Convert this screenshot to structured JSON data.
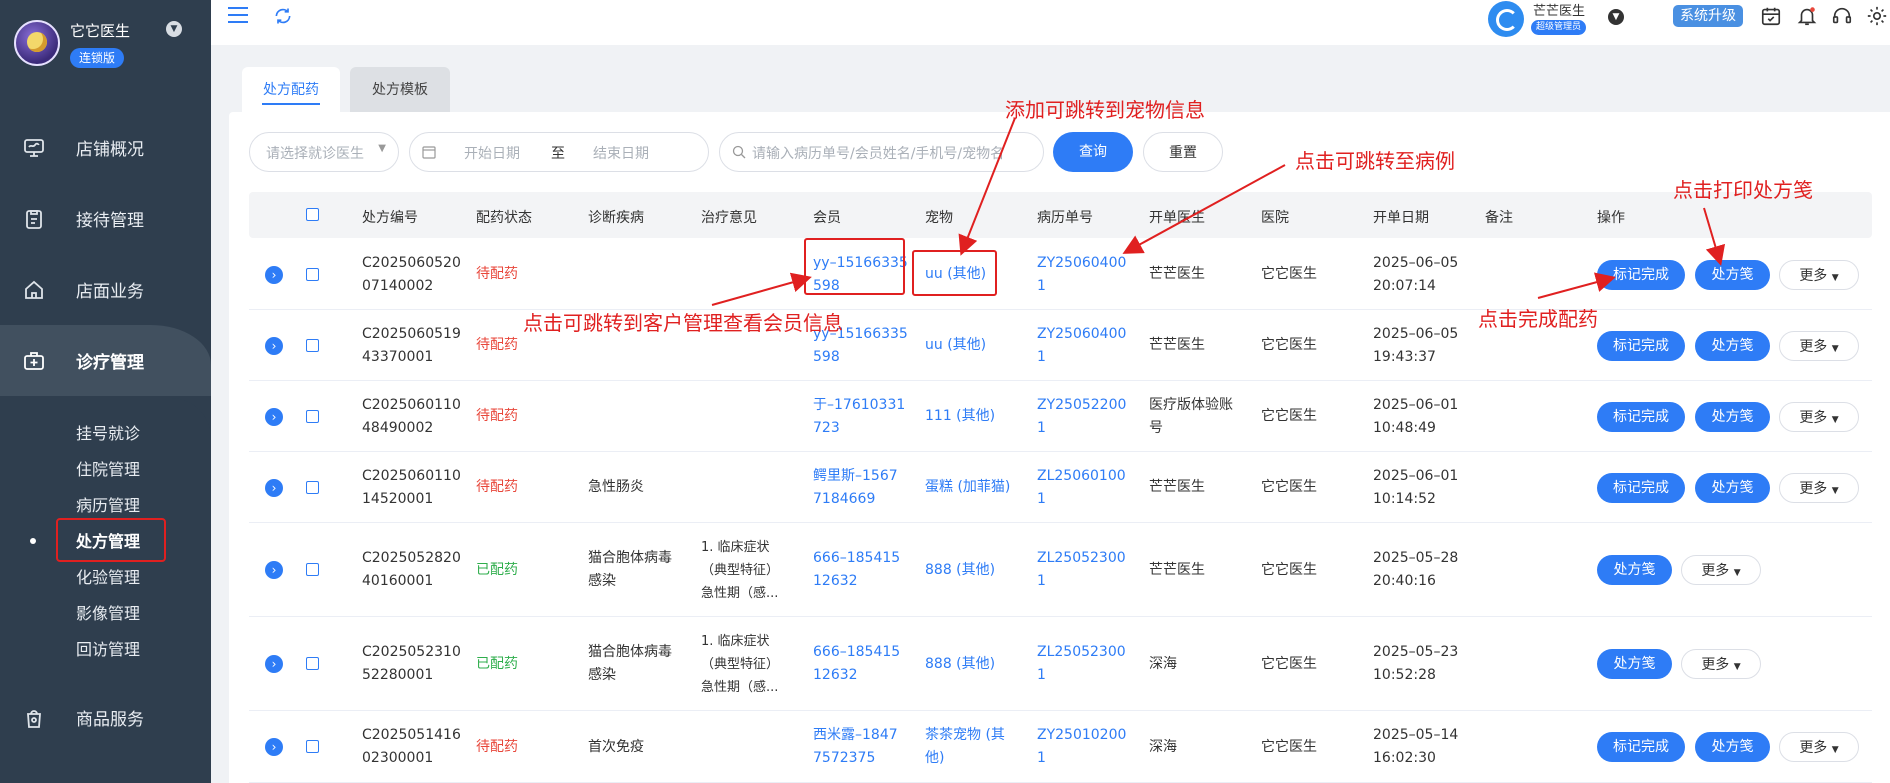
{
  "sidebar": {
    "brand_name": "它它医生",
    "brand_badge": "连锁版",
    "nav": [
      {
        "label": "店铺概况",
        "icon": "monitor-icon"
      },
      {
        "label": "接待管理",
        "icon": "clipboard-icon"
      },
      {
        "label": "店面业务",
        "icon": "house-icon"
      },
      {
        "label": "诊疗管理",
        "icon": "medical-kit-icon"
      },
      {
        "label": "商品服务",
        "icon": "bag-icon"
      }
    ],
    "sub_items": [
      "挂号就诊",
      "住院管理",
      "病历管理",
      "处方管理",
      "化验管理",
      "影像管理",
      "回访管理"
    ]
  },
  "topbar": {
    "user_name": "芒芒医生",
    "user_role": "超级管理员",
    "upgrade": "系统升级"
  },
  "tabs": [
    "处方配药",
    "处方模板"
  ],
  "filters": {
    "doctor_placeholder": "请选择就诊医生",
    "start_placeholder": "开始日期",
    "to": "至",
    "end_placeholder": "结束日期",
    "search_placeholder": "请输入病历单号/会员姓名/手机号/宠物名",
    "query": "查询",
    "reset": "重置"
  },
  "table": {
    "headers": [
      "处方编号",
      "配药状态",
      "诊断疾病",
      "治疗意见",
      "会员",
      "宠物",
      "病历单号",
      "开单医生",
      "医院",
      "开单日期",
      "备注",
      "操作"
    ],
    "rows": [
      {
        "id1": "C2025060520",
        "id2": "07140002",
        "status": "待配药",
        "done": false,
        "diag1": "",
        "diag2": "",
        "opinion": [
          "",
          "",
          ""
        ],
        "member1": "yy–15166335",
        "member2": "598",
        "pet1": "uu (其他)",
        "pet2": "",
        "case1": "ZY25060400",
        "case2": "1",
        "doctor1": "芒芒医生",
        "doctor2": "",
        "hospital": "它它医生",
        "date1": "2025–06–05",
        "date2": "20:07:14"
      },
      {
        "id1": "C2025060519",
        "id2": "43370001",
        "status": "待配药",
        "done": false,
        "diag1": "",
        "diag2": "",
        "opinion": [
          "",
          "",
          ""
        ],
        "member1": "yy–15166335",
        "member2": "598",
        "pet1": "uu (其他)",
        "pet2": "",
        "case1": "ZY25060400",
        "case2": "1",
        "doctor1": "芒芒医生",
        "doctor2": "",
        "hospital": "它它医生",
        "date1": "2025–06–05",
        "date2": "19:43:37"
      },
      {
        "id1": "C2025060110",
        "id2": "48490002",
        "status": "待配药",
        "done": false,
        "diag1": "",
        "diag2": "",
        "opinion": [
          "",
          "",
          ""
        ],
        "member1": "于–17610331",
        "member2": "723",
        "pet1": "111 (其他)",
        "pet2": "",
        "case1": "ZY25052200",
        "case2": "1",
        "doctor1": "医疗版体验账",
        "doctor2": "号",
        "hospital": "它它医生",
        "date1": "2025–06–01",
        "date2": "10:48:49"
      },
      {
        "id1": "C2025060110",
        "id2": "14520001",
        "status": "待配药",
        "done": false,
        "diag1": "急性肠炎",
        "diag2": "",
        "opinion": [
          "",
          "",
          ""
        ],
        "member1": "鳄里斯–1567",
        "member2": "7184669",
        "pet1": "蛋糕 (加菲猫)",
        "pet2": "",
        "case1": "ZL25060100",
        "case2": "1",
        "doctor1": "芒芒医生",
        "doctor2": "",
        "hospital": "它它医生",
        "date1": "2025–06–01",
        "date2": "10:14:52"
      },
      {
        "id1": "C2025052820",
        "id2": "40160001",
        "status": "已配药",
        "done": true,
        "diag1": "猫合胞体病毒",
        "diag2": "感染",
        "opinion": [
          "1. 临床症状",
          "（典型特征）",
          "急性期（感..."
        ],
        "member1": "666–185415",
        "member2": "12632",
        "pet1": "888 (其他)",
        "pet2": "",
        "case1": "ZL25052300",
        "case2": "1",
        "doctor1": "芒芒医生",
        "doctor2": "",
        "hospital": "它它医生",
        "date1": "2025–05–28",
        "date2": "20:40:16"
      },
      {
        "id1": "C2025052310",
        "id2": "52280001",
        "status": "已配药",
        "done": true,
        "diag1": "猫合胞体病毒",
        "diag2": "感染",
        "opinion": [
          "1. 临床症状",
          "（典型特征）",
          "急性期（感..."
        ],
        "member1": "666–185415",
        "member2": "12632",
        "pet1": "888 (其他)",
        "pet2": "",
        "case1": "ZL25052300",
        "case2": "1",
        "doctor1": "深海",
        "doctor2": "",
        "hospital": "它它医生",
        "date1": "2025–05–23",
        "date2": "10:52:28"
      },
      {
        "id1": "C2025051416",
        "id2": "02300001",
        "status": "待配药",
        "done": false,
        "diag1": "首次免疫",
        "diag2": "",
        "opinion": [
          "",
          "",
          ""
        ],
        "member1": "西米露–1847",
        "member2": "7572375",
        "pet1": "茶茶宠物 (其",
        "pet2": "他)",
        "case1": "ZY25010200",
        "case2": "1",
        "doctor1": "深海",
        "doctor2": "",
        "hospital": "它它医生",
        "date1": "2025–05–14",
        "date2": "16:02:30"
      }
    ],
    "btn_mark": "标记完成",
    "btn_print": "处方笺",
    "btn_more": "更多"
  },
  "annotations": {
    "pet": "添加可跳转到宠物信息",
    "case": "点击可跳转至病例",
    "print": "点击打印处方笺",
    "member": "点击可跳转到客户管理查看会员信息",
    "complete": "点击完成配药"
  }
}
